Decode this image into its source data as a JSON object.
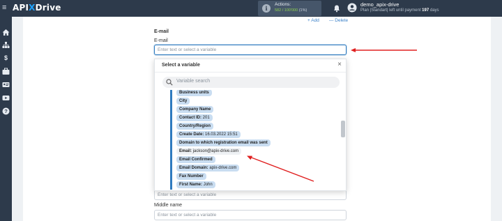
{
  "header": {
    "logo_api": "API",
    "logo_x": "X",
    "logo_drive": "Drive",
    "actions_label": "Actions:",
    "actions_used": "582",
    "actions_total": "/ 100'000",
    "actions_pct": "(1%)",
    "username": "demo_apix-drive",
    "plan_prefix": "Plan |Standart| left until payment",
    "plan_days": "197",
    "plan_suffix": "days"
  },
  "form": {
    "add_label": "+ Add",
    "delete_label": "— Delete",
    "section_title": "E-mail",
    "email_label": "E-mail",
    "email_placeholder": "Enter text or select a variable",
    "next_placeholder": "Enter text or select a variable",
    "middle_name_label": "Middle name",
    "middle_name_placeholder": "Enter text or select a variable"
  },
  "dropdown": {
    "title": "Select a variable",
    "search_placeholder": "Variable search",
    "variables": [
      {
        "name": "Business units",
        "value": ""
      },
      {
        "name": "City",
        "value": ""
      },
      {
        "name": "Company Name",
        "value": ""
      },
      {
        "name": "Contact ID:",
        "value": "201"
      },
      {
        "name": "Country/Region",
        "value": ""
      },
      {
        "name": "Create Date:",
        "value": "16.03.2022 15:51"
      },
      {
        "name": "Domain to which registration email was sent",
        "value": ""
      },
      {
        "name": "Email:",
        "value": "jackson@apix-drive.com"
      },
      {
        "name": "Email Confirmed",
        "value": ""
      },
      {
        "name": "Email Domain:",
        "value": "apix-drive.com"
      },
      {
        "name": "Fax Number",
        "value": ""
      },
      {
        "name": "First Name:",
        "value": "John"
      }
    ]
  },
  "colors": {
    "nav_bg": "#2d3a4b",
    "accent": "#2f7bbf",
    "variable_chip": "#c9ddf1",
    "arrow": "#e02020"
  }
}
